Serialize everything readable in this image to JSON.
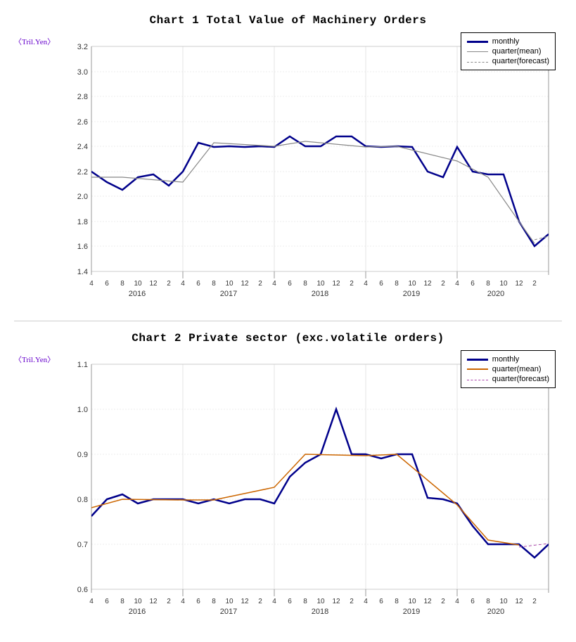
{
  "chart1": {
    "title": "Chart 1  Total Value of Machinery Orders",
    "yAxisLabel": "〈Tril.Yen〉",
    "yMin": 1.4,
    "yMax": 3.2,
    "yTicks": [
      1.4,
      1.6,
      1.8,
      2.0,
      2.2,
      2.4,
      2.6,
      2.8,
      3.0,
      3.2
    ],
    "legend": {
      "monthly": "monthly",
      "quarterMean": "quarter(mean)",
      "quarterForecast": "quarter(forecast)"
    },
    "xYears": [
      "2016",
      "2017",
      "2018",
      "2019",
      "2020"
    ],
    "xMonths": [
      "4",
      "6",
      "8",
      "10",
      "12",
      "2",
      "4",
      "6",
      "8",
      "10",
      "12",
      "2",
      "4",
      "6",
      "8",
      "10",
      "12",
      "2",
      "4",
      "6",
      "8",
      "10",
      "12",
      "2",
      "4",
      "6",
      "8",
      "10",
      "12",
      "2"
    ]
  },
  "chart2": {
    "title": "Chart 2  Private sector (exc.volatile orders)",
    "yAxisLabel": "〈Tril.Yen〉",
    "yMin": 0.6,
    "yMax": 1.1,
    "yTicks": [
      0.6,
      0.7,
      0.8,
      0.9,
      1.0,
      1.1
    ],
    "legend": {
      "monthly": "monthly",
      "quarterMean": "quarter(mean)",
      "quarterForecast": "quarter(forecast)"
    },
    "xYears": [
      "2016",
      "2017",
      "2018",
      "2019",
      "2020"
    ],
    "xMonths": [
      "4",
      "6",
      "8",
      "10",
      "12",
      "2",
      "4",
      "6",
      "8",
      "10",
      "12",
      "2",
      "4",
      "6",
      "8",
      "10",
      "12",
      "2",
      "4",
      "6",
      "8",
      "10",
      "12",
      "2",
      "4",
      "6",
      "8",
      "10",
      "12",
      "2"
    ]
  }
}
